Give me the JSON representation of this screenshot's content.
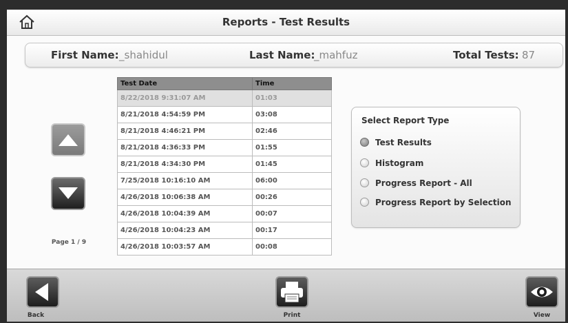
{
  "window": {
    "title": "Reports - Test Results"
  },
  "info": {
    "first_name_label": "First Name:",
    "first_name_value": "_shahidul",
    "last_name_label": "Last Name:",
    "last_name_value": "_mahfuz",
    "total_tests_label": "Total Tests:",
    "total_tests_value": "87"
  },
  "pager": {
    "page_text": "Page 1 / 9"
  },
  "table": {
    "headers": [
      "Test Date",
      "Time"
    ],
    "rows": [
      {
        "date": "8/22/2018 9:31:07 AM",
        "time": "01:03",
        "selected": true
      },
      {
        "date": "8/21/2018 4:54:59 PM",
        "time": "03:08"
      },
      {
        "date": "8/21/2018 4:46:21 PM",
        "time": "02:46"
      },
      {
        "date": "8/21/2018 4:36:33 PM",
        "time": "01:55"
      },
      {
        "date": "8/21/2018 4:34:30 PM",
        "time": "01:45"
      },
      {
        "date": "7/25/2018 10:16:10 AM",
        "time": "06:00"
      },
      {
        "date": "4/26/2018 10:06:38 AM",
        "time": "00:26"
      },
      {
        "date": "4/26/2018 10:04:39 AM",
        "time": "00:07"
      },
      {
        "date": "4/26/2018 10:04:23 AM",
        "time": "00:17"
      },
      {
        "date": "4/26/2018 10:03:57 AM",
        "time": "00:08"
      }
    ]
  },
  "report_type": {
    "title": "Select Report Type",
    "options": [
      {
        "label": "Test Results",
        "selected": true
      },
      {
        "label": "Histogram"
      },
      {
        "label": "Progress Report - All"
      },
      {
        "label": "Progress Report by Selection"
      }
    ]
  },
  "bottom": {
    "back_label": "Back",
    "print_label": "Print",
    "view_label": "View"
  },
  "icons": {
    "home": "home-icon",
    "up": "arrow-up-icon",
    "down": "arrow-down-icon",
    "back": "arrow-left-icon",
    "print": "printer-icon",
    "view": "eye-icon"
  }
}
